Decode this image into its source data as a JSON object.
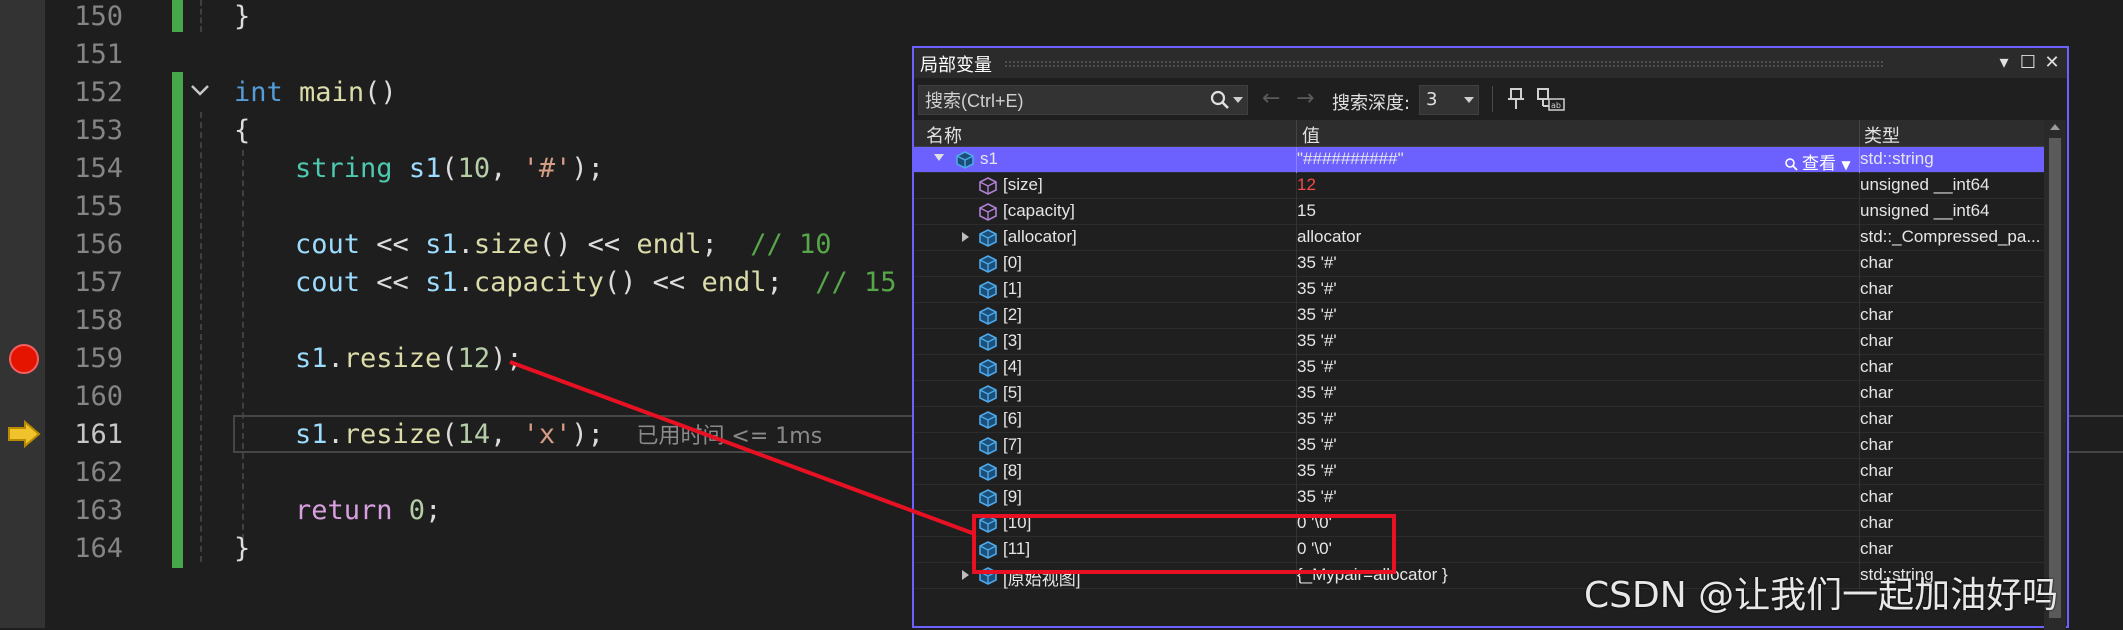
{
  "editor": {
    "lines": [
      {
        "num": "150"
      },
      {
        "num": "151"
      },
      {
        "num": "152"
      },
      {
        "num": "153"
      },
      {
        "num": "154"
      },
      {
        "num": "155"
      },
      {
        "num": "156"
      },
      {
        "num": "157"
      },
      {
        "num": "158"
      },
      {
        "num": "159"
      },
      {
        "num": "160"
      },
      {
        "num": "161"
      },
      {
        "num": "162"
      },
      {
        "num": "163"
      },
      {
        "num": "164"
      }
    ],
    "code": {
      "l150": "}",
      "l152_kw": "int",
      "l152_fn": "main",
      "l152_rest": "()",
      "l153": "{",
      "l154_type": "string",
      "l154_var": "s1",
      "l154_open": "(",
      "l154_num": "10",
      "l154_comma": ", ",
      "l154_str": "'#'",
      "l154_close": ");",
      "l156_a": "cout",
      "l156_op1": " << ",
      "l156_var": "s1",
      "l156_dot": ".",
      "l156_fn": "size",
      "l156_par": "()",
      "l156_op2": " << ",
      "l156_endl": "endl",
      "l156_semi": ";  ",
      "l156_cm": "// 10",
      "l157_a": "cout",
      "l157_op1": " << ",
      "l157_var": "s1",
      "l157_dot": ".",
      "l157_fn": "capacity",
      "l157_par": "()",
      "l157_op2": " << ",
      "l157_endl": "endl",
      "l157_semi": ";  ",
      "l157_cm": "// 15",
      "l159_var": "s1",
      "l159_dot": ".",
      "l159_fn": "resize",
      "l159_open": "(",
      "l159_num": "12",
      "l159_close": ");",
      "l161_var": "s1",
      "l161_dot": ".",
      "l161_fn": "resize",
      "l161_open": "(",
      "l161_num": "14",
      "l161_comma": ", ",
      "l161_str": "'x'",
      "l161_close": ");",
      "l161_elapsed": "已用时间 <= 1ms",
      "l163_kw": "return",
      "l163_num": " 0",
      "l163_semi": ";",
      "l164": "}"
    }
  },
  "locals": {
    "title": "局部变量",
    "search_placeholder": "搜索(Ctrl+E)",
    "depth_label": "搜索深度:",
    "depth_value": "3",
    "nav_back": "←",
    "nav_forward": "→",
    "title_buttons": {
      "dropdown": "▾",
      "maximize": "☐",
      "close": "✕"
    },
    "columns": {
      "name": "名称",
      "value": "值",
      "type": "类型"
    },
    "viewer_label": "查看",
    "rows": [
      {
        "name": "s1",
        "value": "\"##########\"",
        "type": "std::string"
      },
      {
        "name": "[size]",
        "value": "12",
        "type": "unsigned __int64"
      },
      {
        "name": "[capacity]",
        "value": "15",
        "type": "unsigned __int64"
      },
      {
        "name": "[allocator]",
        "value": "allocator",
        "type": "std::_Compressed_pa..."
      },
      {
        "name": "[0]",
        "value": "35 '#'",
        "type": "char"
      },
      {
        "name": "[1]",
        "value": "35 '#'",
        "type": "char"
      },
      {
        "name": "[2]",
        "value": "35 '#'",
        "type": "char"
      },
      {
        "name": "[3]",
        "value": "35 '#'",
        "type": "char"
      },
      {
        "name": "[4]",
        "value": "35 '#'",
        "type": "char"
      },
      {
        "name": "[5]",
        "value": "35 '#'",
        "type": "char"
      },
      {
        "name": "[6]",
        "value": "35 '#'",
        "type": "char"
      },
      {
        "name": "[7]",
        "value": "35 '#'",
        "type": "char"
      },
      {
        "name": "[8]",
        "value": "35 '#'",
        "type": "char"
      },
      {
        "name": "[9]",
        "value": "35 '#'",
        "type": "char"
      },
      {
        "name": "[10]",
        "value": "0 '\\0'",
        "type": "char"
      },
      {
        "name": "[11]",
        "value": "0 '\\0'",
        "type": "char"
      },
      {
        "name": "[原始视图]",
        "value": "{_Mypair=allocator }",
        "type": "std::string"
      }
    ]
  },
  "colors": {
    "accent": "#6c61ff",
    "annotation": "#e81123",
    "changed_value": "#f44b4b",
    "change_bar": "#47a84b"
  },
  "watermark": "CSDN @让我们一起加油好吗"
}
